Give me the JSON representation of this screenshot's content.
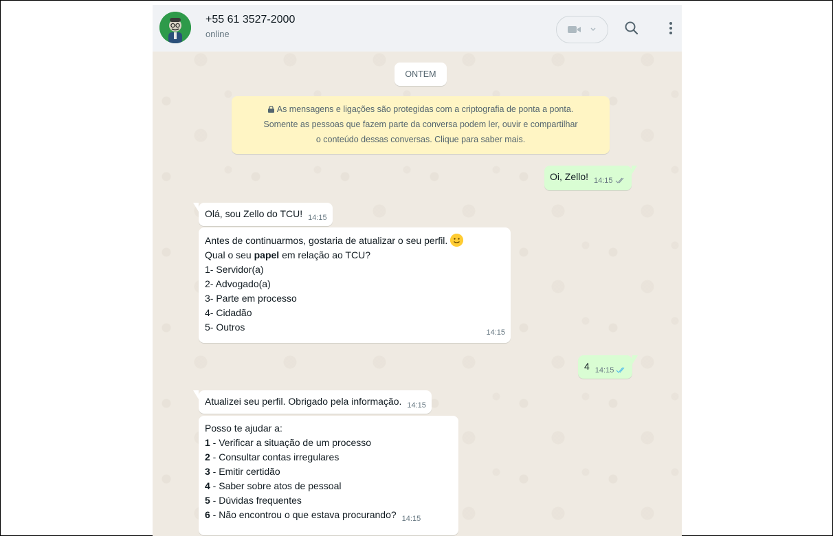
{
  "header": {
    "contact_name": "+55 61 3527-2000",
    "contact_status": "online",
    "icons": [
      "avatar",
      "video-call-icon",
      "search-icon",
      "menu-icon"
    ]
  },
  "chat": {
    "date_separator": "ONTEM",
    "encryption_notice": {
      "line1": "As mensagens e ligações são protegidas com a criptografia de ponta a ponta.",
      "line2": "Somente as pessoas que fazem parte da conversa podem ler, ouvir e compartilhar",
      "line3": "o conteúdo dessas conversas. Clique para saber mais."
    },
    "messages": [
      {
        "direction": "out",
        "text": "Oi, Zello!",
        "time": "14:15"
      },
      {
        "direction": "in",
        "text": "Olá, sou Zello do TCU!",
        "time": "14:15"
      },
      {
        "direction": "in",
        "line1": "Antes de continuarmos, gostaria de atualizar o seu perfil.",
        "line2_pre": "Qual o seu ",
        "line2_bold": "papel",
        "line2_post": " em relação ao TCU?",
        "options": [
          "1- Servidor(a)",
          "2- Advogado(a)",
          "3- Parte em processo",
          "4- Cidadão",
          "5- Outros"
        ],
        "time": "14:15"
      },
      {
        "direction": "out",
        "text": "4",
        "time": "14:15"
      },
      {
        "direction": "in",
        "text": "Atualizei seu perfil. Obrigado pela informação.",
        "time": "14:15"
      },
      {
        "direction": "in",
        "intro": "Posso te ajudar a:",
        "menu": [
          {
            "num": "1",
            "label": " - Verificar a situação de um processo"
          },
          {
            "num": "2",
            "label": " - Consultar contas irregulares"
          },
          {
            "num": "3",
            "label": " - Emitir certidão"
          },
          {
            "num": "4",
            "label": " - Saber sobre atos de pessoal"
          },
          {
            "num": "5",
            "label": " - Dúvidas frequentes"
          },
          {
            "num": "6",
            "label": " - Não encontrou o que estava procurando?"
          }
        ],
        "time": "14:15"
      }
    ]
  },
  "colors": {
    "chat_background": "#efeae2",
    "header_background": "#f0f2f5",
    "outgoing_bubble": "#d9fdd3",
    "incoming_bubble": "#ffffff",
    "encryption_notice_bg": "#fff5c4",
    "read_ticks": "#53bdeb",
    "avatar_bg": "#2e9a4a"
  }
}
